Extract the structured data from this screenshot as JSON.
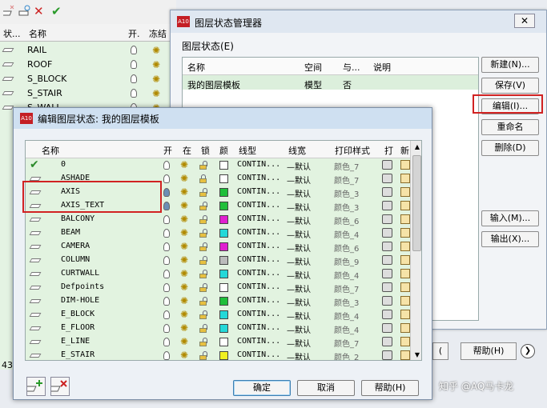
{
  "bg_panel": {
    "headers": {
      "status": "状...",
      "name": "名称",
      "on": "开.",
      "freeze": "冻结"
    },
    "rows": [
      "RAIL",
      "ROOF",
      "S_BLOCK",
      "S_STAIR",
      "S_WALL"
    ],
    "status_text": "43"
  },
  "manager": {
    "title": "图层状态管理器",
    "close": "✕",
    "section_label": "图层状态(E)",
    "columns": {
      "name": "名称",
      "space": "空间",
      "same": "与...",
      "desc": "说明"
    },
    "row": {
      "name": "我的图层模板",
      "space": "模型",
      "same": "否",
      "desc": ""
    },
    "buttons": {
      "new": "新建(N)...",
      "save": "保存(V)",
      "edit": "编辑(I)...",
      "rename": "重命名",
      "delete": "删除(D)",
      "import": "输入(M)...",
      "export": "输出(X)..."
    },
    "bottom": {
      "prev": "(",
      "help": "帮助(H)"
    }
  },
  "edit_dialog": {
    "title": "编辑图层状态: 我的图层模板",
    "columns": {
      "name": "名称",
      "on": "开",
      "thaw": "在",
      "lock": "锁",
      "color": "颜",
      "linetype": "线型",
      "lineweight": "线宽",
      "plotstyle": "打印样式",
      "plot": "打",
      "new": "新"
    },
    "rows": [
      {
        "name": "0",
        "current": true,
        "on": true,
        "locked": false,
        "color": "#ffffff",
        "linetype": "CONTIN...",
        "lineweight": "—默认",
        "plotstyle": "颜色_7"
      },
      {
        "name": "ASHADE",
        "current": false,
        "on": true,
        "locked": true,
        "color": "#ffffff",
        "linetype": "CONTIN...",
        "lineweight": "—默认",
        "plotstyle": "颜色_7"
      },
      {
        "name": "AXIS",
        "current": false,
        "on": false,
        "locked": false,
        "color": "#1fbf3a",
        "linetype": "CONTIN...",
        "lineweight": "—默认",
        "plotstyle": "颜色_3"
      },
      {
        "name": "AXIS_TEXT",
        "current": false,
        "on": false,
        "locked": false,
        "color": "#1fbf3a",
        "linetype": "CONTIN...",
        "lineweight": "—默认",
        "plotstyle": "颜色_3"
      },
      {
        "name": "BALCONY",
        "current": false,
        "on": true,
        "locked": false,
        "color": "#e020d0",
        "linetype": "CONTIN...",
        "lineweight": "—默认",
        "plotstyle": "颜色_6"
      },
      {
        "name": "BEAM",
        "current": false,
        "on": true,
        "locked": false,
        "color": "#24d8d8",
        "linetype": "CONTIN...",
        "lineweight": "—默认",
        "plotstyle": "颜色_4"
      },
      {
        "name": "CAMERA",
        "current": false,
        "on": true,
        "locked": false,
        "color": "#e020d0",
        "linetype": "CONTIN...",
        "lineweight": "—默认",
        "plotstyle": "颜色_6"
      },
      {
        "name": "COLUMN",
        "current": false,
        "on": true,
        "locked": false,
        "color": "#bbbbbb",
        "linetype": "CONTIN...",
        "lineweight": "—默认",
        "plotstyle": "颜色_9"
      },
      {
        "name": "CURTWALL",
        "current": false,
        "on": true,
        "locked": false,
        "color": "#24d8d8",
        "linetype": "CONTIN...",
        "lineweight": "—默认",
        "plotstyle": "颜色_4"
      },
      {
        "name": "Defpoints",
        "current": false,
        "on": true,
        "locked": false,
        "color": "#ffffff",
        "linetype": "CONTIN...",
        "lineweight": "—默认",
        "plotstyle": "颜色_7"
      },
      {
        "name": "DIM-HOLE",
        "current": false,
        "on": true,
        "locked": false,
        "color": "#1fbf3a",
        "linetype": "CONTIN...",
        "lineweight": "—默认",
        "plotstyle": "颜色_3"
      },
      {
        "name": "E_BLOCK",
        "current": false,
        "on": true,
        "locked": false,
        "color": "#24d8d8",
        "linetype": "CONTIN...",
        "lineweight": "—默认",
        "plotstyle": "颜色_4"
      },
      {
        "name": "E_FLOOR",
        "current": false,
        "on": true,
        "locked": false,
        "color": "#24d8d8",
        "linetype": "CONTIN...",
        "lineweight": "—默认",
        "plotstyle": "颜色_4"
      },
      {
        "name": "E_LINE",
        "current": false,
        "on": true,
        "locked": false,
        "color": "#ffffff",
        "linetype": "CONTIN...",
        "lineweight": "—默认",
        "plotstyle": "颜色_7"
      },
      {
        "name": "E_STAIR",
        "current": false,
        "on": true,
        "locked": false,
        "color": "#f0f020",
        "linetype": "CONTIN...",
        "lineweight": "—默认",
        "plotstyle": "颜色_2"
      }
    ],
    "buttons": {
      "ok": "确定",
      "cancel": "取消",
      "help": "帮助(H)"
    }
  },
  "watermark": "知乎 @AQ马卡龙"
}
